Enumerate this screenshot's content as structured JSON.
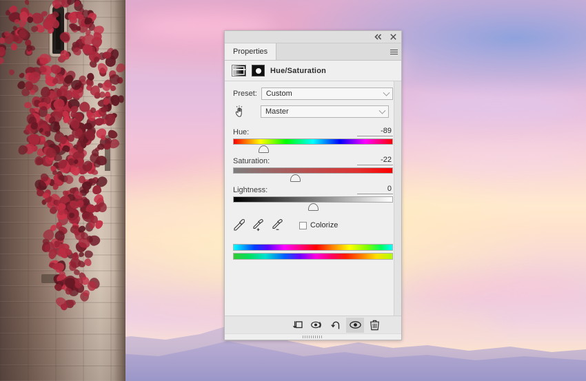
{
  "panel": {
    "topbar": {
      "collapse_icon": "double-chevron-left-icon",
      "close_icon": "close-icon"
    },
    "tab_label": "Properties",
    "menu_icon": "panel-menu-icon",
    "adjustment": {
      "title": "Hue/Saturation",
      "adjustment_thumb_icon": "hue-saturation-thumbnail-icon",
      "mask_thumb_icon": "layer-mask-thumbnail-icon"
    },
    "preset": {
      "label": "Preset:",
      "value": "Custom"
    },
    "channel": {
      "target_tool_icon": "targeted-adjustment-hand-icon",
      "value": "Master"
    },
    "sliders": [
      {
        "label": "Hue:",
        "value": "-89",
        "position": 19,
        "track": "hue"
      },
      {
        "label": "Saturation:",
        "value": "-22",
        "position": 39,
        "track": "sat"
      },
      {
        "label": "Lightness:",
        "value": "0",
        "position": 50,
        "track": "light"
      }
    ],
    "tools": {
      "eyedropper_icon": "eyedropper-icon",
      "eyedropper_add_icon": "eyedropper-add-icon",
      "eyedropper_subtract_icon": "eyedropper-subtract-icon",
      "colorize_label": "Colorize",
      "colorize_checked": false
    },
    "spectrums": {
      "top_name": "source-color-spectrum",
      "bottom_name": "result-color-spectrum"
    },
    "footer": [
      {
        "name": "clip-to-layer-button",
        "icon": "clip-to-layer-icon",
        "active": false
      },
      {
        "name": "toggle-mask-button",
        "icon": "view-previous-state-icon",
        "active": false
      },
      {
        "name": "reset-button",
        "icon": "reset-icon",
        "active": false
      },
      {
        "name": "toggle-visibility-button",
        "icon": "eye-icon",
        "active": true
      },
      {
        "name": "delete-layer-button",
        "icon": "trash-icon",
        "active": false
      }
    ]
  },
  "background": {
    "scene": "stone-tower-with-red-ivy-against-pastel-sunset-sky",
    "colors": {
      "sky_top": "#d9b2d6",
      "sky_glow": "#ffe9cf",
      "sky_blue": "#809ede",
      "mountain": "#9f9ccd",
      "ivy": "#9e2638",
      "stone_light": "#d6c7b8",
      "stone_dark": "#5d4a44"
    }
  }
}
